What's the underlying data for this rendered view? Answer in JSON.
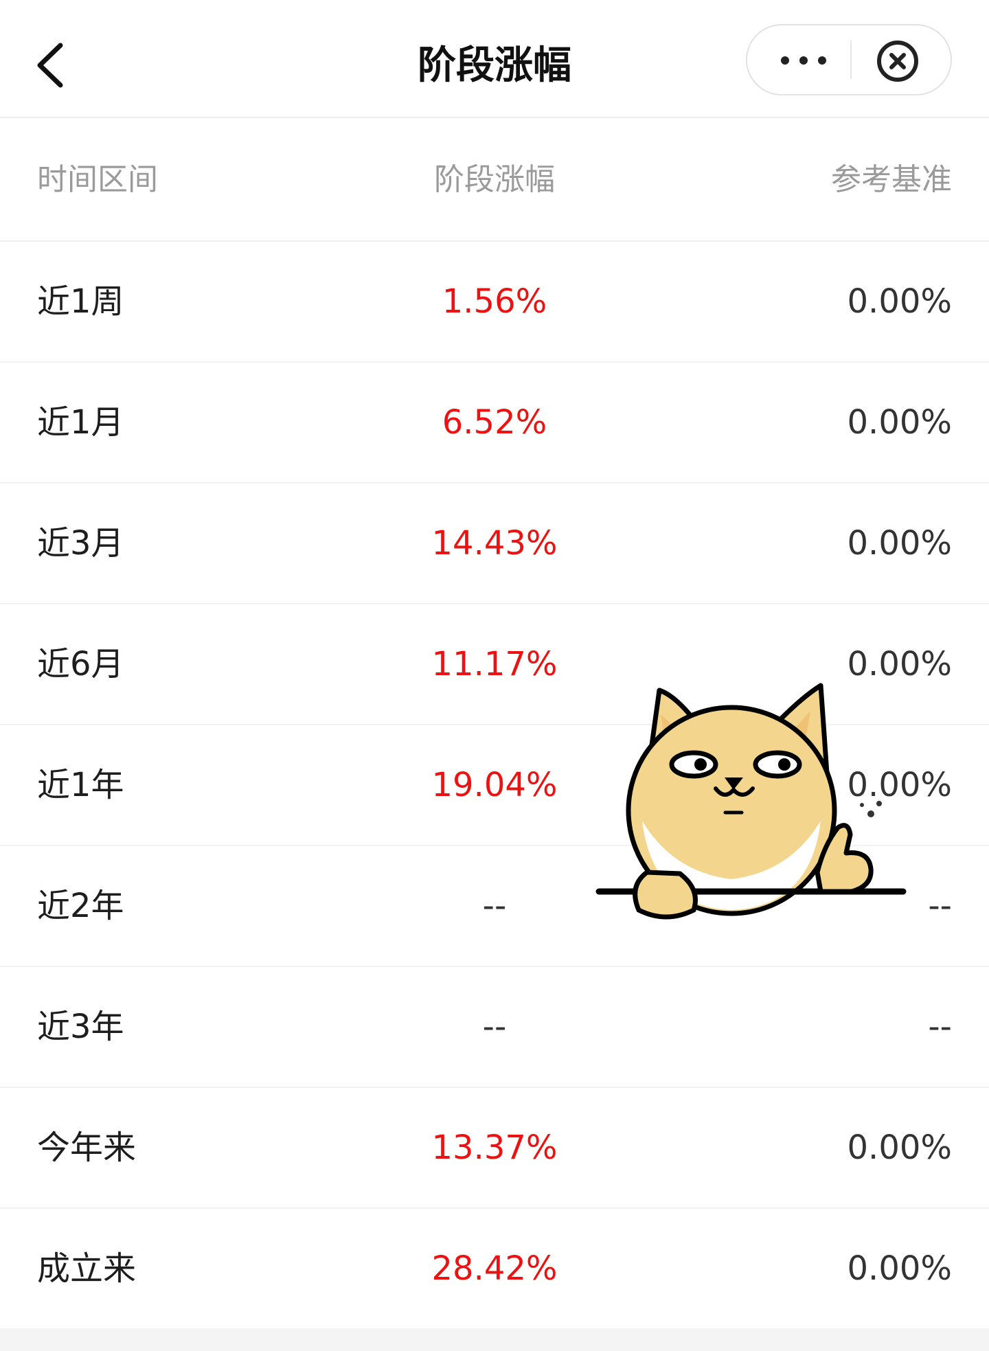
{
  "header": {
    "title": "阶段涨幅",
    "back_icon": "chevron-left-icon",
    "more_icon": "more-dots-icon",
    "close_icon": "circle-close-icon"
  },
  "table": {
    "columns": [
      "时间区间",
      "阶段涨幅",
      "参考基准"
    ],
    "rows": [
      {
        "period": "近1周",
        "change": "1.56%",
        "benchmark": "0.00%"
      },
      {
        "period": "近1月",
        "change": "6.52%",
        "benchmark": "0.00%"
      },
      {
        "period": "近3月",
        "change": "14.43%",
        "benchmark": "0.00%"
      },
      {
        "period": "近6月",
        "change": "11.17%",
        "benchmark": "0.00%"
      },
      {
        "period": "近1年",
        "change": "19.04%",
        "benchmark": "0.00%"
      },
      {
        "period": "近2年",
        "change": "--",
        "benchmark": "--"
      },
      {
        "period": "近3年",
        "change": "--",
        "benchmark": "--"
      },
      {
        "period": "今年来",
        "change": "13.37%",
        "benchmark": "0.00%"
      },
      {
        "period": "成立来",
        "change": "28.42%",
        "benchmark": "0.00%"
      }
    ]
  },
  "colors": {
    "positive": "#ee1111",
    "neutral": "#333333",
    "header_text": "#9a9a9a"
  },
  "sticker": {
    "icon": "shiba-dog-thumbs-up-sticker"
  }
}
